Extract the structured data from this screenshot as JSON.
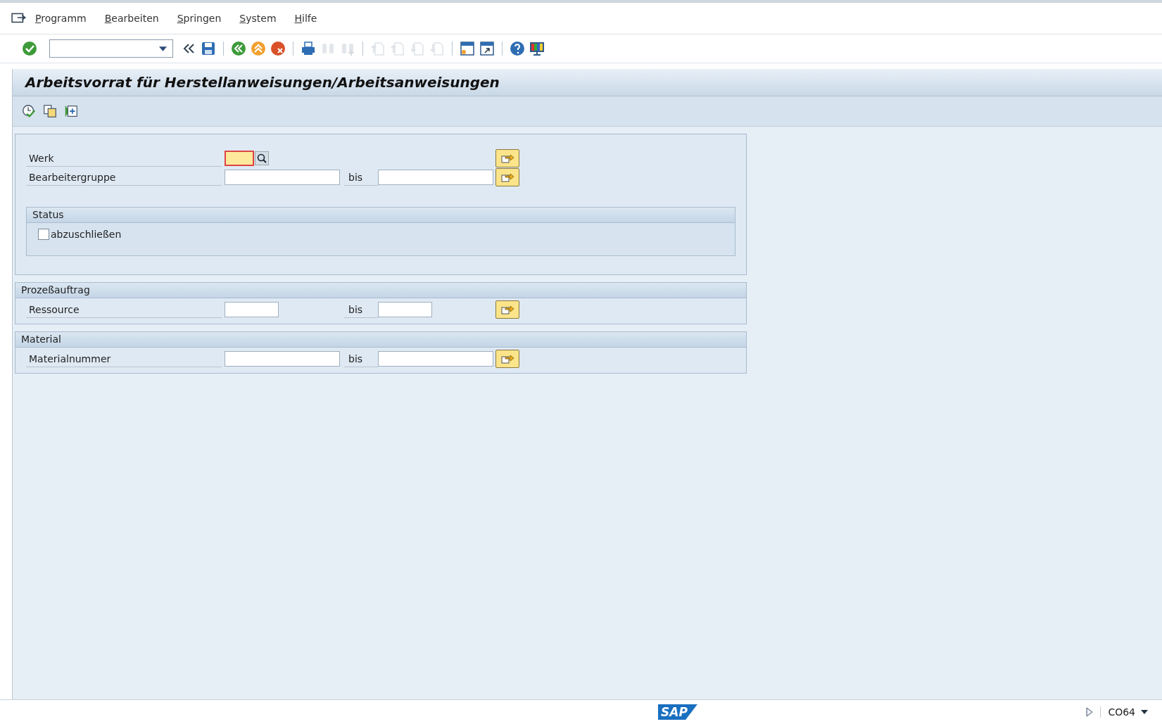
{
  "menu": [
    {
      "label": "Programm"
    },
    {
      "label": "Bearbeiten"
    },
    {
      "label": "Springen"
    },
    {
      "label": "System"
    },
    {
      "label": "Hilfe"
    }
  ],
  "toolbar": [
    {
      "kind": "enter",
      "disabled": false
    },
    {
      "kind": "command_field"
    },
    {
      "kind": "collapse",
      "disabled": false
    },
    {
      "kind": "save",
      "disabled": false
    },
    {
      "kind": "separator"
    },
    {
      "kind": "back",
      "disabled": false
    },
    {
      "kind": "exit",
      "disabled": false
    },
    {
      "kind": "cancel",
      "disabled": false
    },
    {
      "kind": "separator"
    },
    {
      "kind": "print",
      "disabled": false
    },
    {
      "kind": "find",
      "disabled": true
    },
    {
      "kind": "find_next",
      "disabled": true
    },
    {
      "kind": "separator"
    },
    {
      "kind": "first_page",
      "disabled": true
    },
    {
      "kind": "prev_page",
      "disabled": true
    },
    {
      "kind": "next_page",
      "disabled": true
    },
    {
      "kind": "last_page",
      "disabled": true
    },
    {
      "kind": "separator"
    },
    {
      "kind": "new_session",
      "disabled": false
    },
    {
      "kind": "shortcut",
      "disabled": false
    },
    {
      "kind": "separator"
    },
    {
      "kind": "help",
      "disabled": false
    },
    {
      "kind": "layout",
      "disabled": false
    }
  ],
  "title": "Arbeitsvorrat für Herstellanweisungen/Arbeitsanweisungen",
  "app_toolbar": [
    {
      "kind": "execute"
    },
    {
      "kind": "variant"
    },
    {
      "kind": "add"
    }
  ],
  "selection": {
    "fields": [
      {
        "label": "Werk",
        "kind": "single",
        "focused": true
      },
      {
        "label": "Bearbeitergruppe",
        "kind": "range",
        "connector": "bis",
        "focused": false
      }
    ],
    "status": {
      "title": "Status",
      "checkboxes": [
        {
          "label": "abzuschließen",
          "checked": false
        }
      ]
    }
  },
  "groups": [
    {
      "title": "Prozeßauftrag",
      "fields": [
        {
          "label": "Ressource",
          "kind": "range_short",
          "connector": "bis",
          "focused": false
        }
      ]
    },
    {
      "title": "Material",
      "fields": [
        {
          "label": "Materialnummer",
          "kind": "range",
          "connector": "bis",
          "focused": false
        }
      ]
    }
  ],
  "status_bar": {
    "logo": "SAP",
    "transaction": "CO64"
  }
}
